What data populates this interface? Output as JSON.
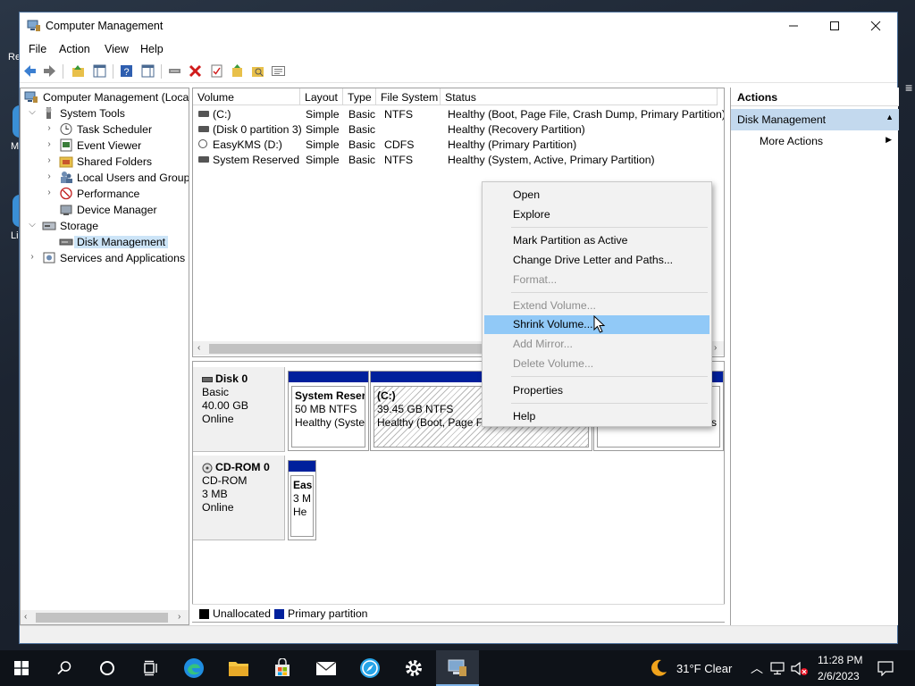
{
  "window": {
    "title": "Computer Management"
  },
  "menubar": [
    "File",
    "Action",
    "View",
    "Help"
  ],
  "tree": [
    {
      "label": "Computer Management (Local",
      "icon": "computer-management-icon"
    },
    {
      "label": "System Tools",
      "icon": "system-tools-icon"
    },
    {
      "label": "Task Scheduler",
      "icon": "clock-icon"
    },
    {
      "label": "Event Viewer",
      "icon": "event-viewer-icon"
    },
    {
      "label": "Shared Folders",
      "icon": "shared-folder-icon"
    },
    {
      "label": "Local Users and Groups",
      "icon": "users-icon"
    },
    {
      "label": "Performance",
      "icon": "performance-icon"
    },
    {
      "label": "Device Manager",
      "icon": "device-manager-icon"
    },
    {
      "label": "Storage",
      "icon": "storage-icon"
    },
    {
      "label": "Disk Management",
      "icon": "disk-icon"
    },
    {
      "label": "Services and Applications",
      "icon": "services-icon"
    }
  ],
  "volumes": {
    "columns": [
      "Volume",
      "Layout",
      "Type",
      "File System",
      "Status"
    ],
    "rows": [
      [
        "(C:)",
        "Simple",
        "Basic",
        "NTFS",
        "Healthy (Boot, Page File, Crash Dump, Primary Partition)"
      ],
      [
        "(Disk 0 partition 3)",
        "Simple",
        "Basic",
        "",
        "Healthy (Recovery Partition)"
      ],
      [
        "EasyKMS (D:)",
        "Simple",
        "Basic",
        "CDFS",
        "Healthy (Primary Partition)"
      ],
      [
        "System Reserved",
        "Simple",
        "Basic",
        "NTFS",
        "Healthy (System, Active, Primary Partition)"
      ]
    ]
  },
  "disks": [
    {
      "name": "Disk 0",
      "type": "Basic",
      "size": "40.00 GB",
      "state": "Online",
      "partitions": [
        {
          "name": "System Reser",
          "size": "50 MB NTFS",
          "status": "Healthy (Syste"
        },
        {
          "name": "(C:)",
          "size": "39.45 GB NTFS",
          "status": "Healthy (Boot, Page Fi"
        },
        {
          "name": "",
          "size": "",
          "status": "s"
        }
      ]
    },
    {
      "name": "CD-ROM 0",
      "type": "CD-ROM",
      "size": "3 MB",
      "state": "Online",
      "partitions": [
        {
          "name": "Eas",
          "size": "3 M",
          "status": "He"
        }
      ]
    }
  ],
  "legend": [
    {
      "label": "Unallocated",
      "color": "#000000"
    },
    {
      "label": "Primary partition",
      "color": "#00209c"
    }
  ],
  "actions": {
    "header": "Actions",
    "section": "Disk Management",
    "more": "More Actions"
  },
  "context_menu": [
    {
      "label": "Open",
      "enabled": true
    },
    {
      "label": "Explore",
      "enabled": true
    },
    {
      "label": "Mark Partition as Active",
      "enabled": true
    },
    {
      "label": "Change Drive Letter and Paths...",
      "enabled": true
    },
    {
      "label": "Format...",
      "enabled": false
    },
    {
      "label": "Extend Volume...",
      "enabled": false
    },
    {
      "label": "Shrink Volume...",
      "enabled": true,
      "highlighted": true
    },
    {
      "label": "Add Mirror...",
      "enabled": false
    },
    {
      "label": "Delete Volume...",
      "enabled": false
    },
    {
      "label": "Properties",
      "enabled": true
    },
    {
      "label": "Help",
      "enabled": true
    }
  ],
  "desktop_fragments": [
    "Re",
    "M",
    "Li"
  ],
  "taskbar": {
    "weather": "31°F  Clear",
    "time": "11:28 PM",
    "date": "2/6/2023"
  },
  "colors": {
    "accent": "#0078d7",
    "highlight": "#91c9f7",
    "partition": "#00209c",
    "selection": "#cce4f7"
  }
}
